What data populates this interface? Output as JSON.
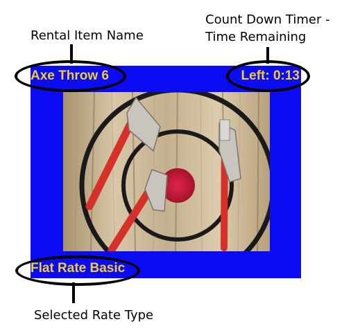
{
  "annotations": {
    "rental_item_name": "Rental Item Name",
    "countdown_line1": "Count Down Timer -",
    "countdown_line2": "Time Remaining",
    "selected_rate_type": "Selected Rate Type"
  },
  "screen": {
    "item_name": "Axe Throw 6",
    "time_left": "Left: 0:13",
    "rate_type": "Flat Rate Basic",
    "background_color": "#0b0bf5",
    "text_color": "#f2cf2a"
  },
  "photo": {
    "subject": "axes-in-wooden-target-image"
  }
}
